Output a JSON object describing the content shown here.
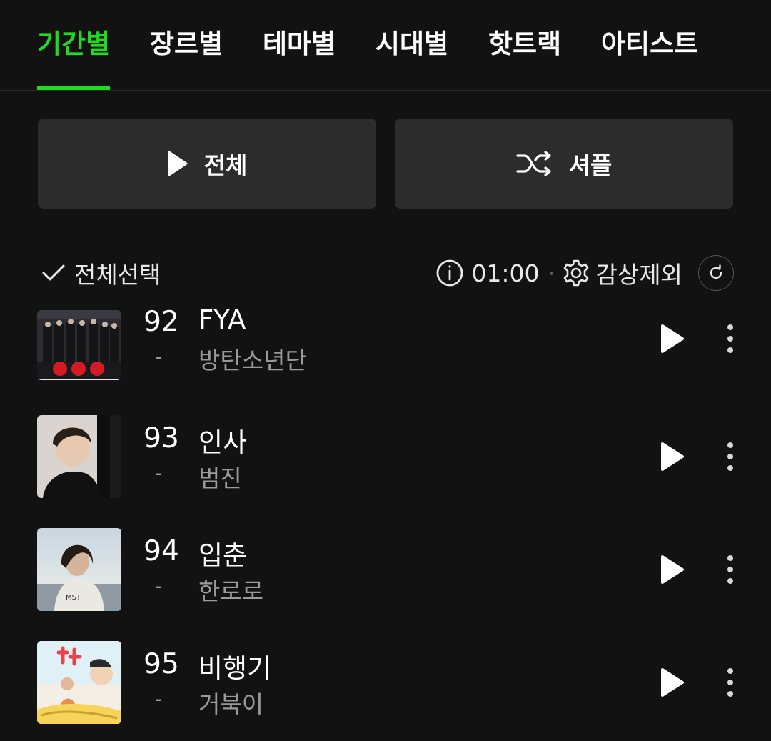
{
  "tabs": [
    {
      "label": "기간별",
      "active": true
    },
    {
      "label": "장르별",
      "active": false
    },
    {
      "label": "테마별",
      "active": false
    },
    {
      "label": "시대별",
      "active": false
    },
    {
      "label": "핫트랙",
      "active": false
    },
    {
      "label": "아티스트",
      "active": false
    }
  ],
  "actions": {
    "play_all_label": "전체",
    "shuffle_label": "셔플"
  },
  "toolbar": {
    "select_all_label": "전체선택",
    "timer_label": "01:00",
    "exclude_label": "감상제외"
  },
  "tracks": [
    {
      "rank": "92",
      "change": "-",
      "title": "FYA",
      "artist": "방탄소년단"
    },
    {
      "rank": "93",
      "change": "-",
      "title": "인사",
      "artist": "범진"
    },
    {
      "rank": "94",
      "change": "-",
      "title": "입춘",
      "artist": "한로로"
    },
    {
      "rank": "95",
      "change": "-",
      "title": "비행기",
      "artist": "거북이"
    }
  ],
  "colors": {
    "accent": "#1fdc22",
    "background": "#121212",
    "button_bg": "#2c2c2c",
    "muted_text": "#9a9a9a"
  },
  "icons": {
    "play_all": "play-icon",
    "shuffle": "shuffle-icon",
    "check": "check-icon",
    "info": "info-icon",
    "settings": "gear-icon",
    "refresh": "refresh-icon",
    "row_play": "play-icon",
    "row_more": "more-vertical-icon"
  }
}
